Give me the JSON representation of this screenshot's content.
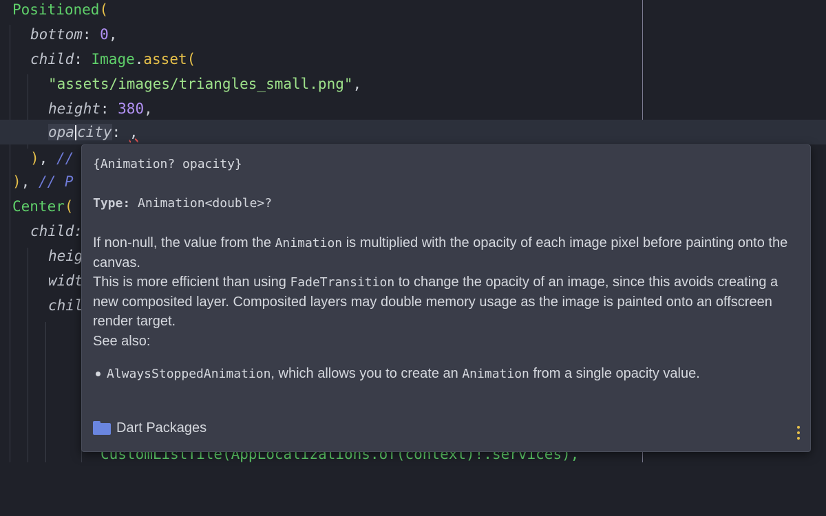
{
  "code": {
    "l1": {
      "ident": "Positioned",
      "paren": "("
    },
    "l2": {
      "name": "bottom",
      "colon": ": ",
      "value": "0",
      "comma": ","
    },
    "l3": {
      "name": "child",
      "colon": ": ",
      "cls": "Image",
      "dot": ".",
      "method": "asset",
      "paren": "("
    },
    "l4": {
      "string": "\"assets/images/triangles_small.png\"",
      "comma": ","
    },
    "l5": {
      "name": "height",
      "colon": ": ",
      "value": "380",
      "comma": ","
    },
    "l6": {
      "name_a": "opa",
      "name_b": "city",
      "colon": ": ",
      "comma": ","
    },
    "l7": {
      "paren": ")",
      "comma": ", ",
      "comment": "//"
    },
    "l8": {
      "paren": ")",
      "comma": ", ",
      "comment": "// P"
    },
    "l9": {
      "ident": "Center",
      "paren": "("
    },
    "l10": {
      "name": "child:"
    },
    "l11": {
      "name": "heig"
    },
    "l12": {
      "name": "widt"
    },
    "l13": {
      "name": "chil"
    },
    "l_bottom": {
      "text": "CustomListTile(AppLocalizations.of(context)!.services),"
    }
  },
  "popup": {
    "signature": "{Animation? opacity}",
    "type_label": "Type:",
    "type_value": "Animation<double>?",
    "desc1_a": "If non-null, the value from the ",
    "desc1_code": "Animation",
    "desc1_b": " is multiplied with the opacity of each image pixel before painting onto the canvas.",
    "desc2_a": "This is more efficient than using ",
    "desc2_code": "FadeTransition",
    "desc2_b": " to change the opacity of an image, since this avoids creating a new composited layer. Composited layers may double memory usage as the image is painted onto an offscreen render target.",
    "see_also": "See also:",
    "bullet_code": "AlwaysStoppedAnimation",
    "bullet_a": ", which allows you to create an ",
    "bullet_code2": "Animation",
    "bullet_b": " from a single opacity value.",
    "footer_label": "Dart Packages",
    "folder_icon": "folder-icon",
    "more_icon": "kebab-menu-icon"
  },
  "colors": {
    "background": "#1f2129",
    "popup_bg": "#3a3d49",
    "keyword_green": "#5fd06a",
    "paren_yellow": "#e6c04a",
    "number_purple": "#b291f5",
    "comment_blue": "#6f7bd8",
    "folder_blue": "#6a86e0"
  }
}
